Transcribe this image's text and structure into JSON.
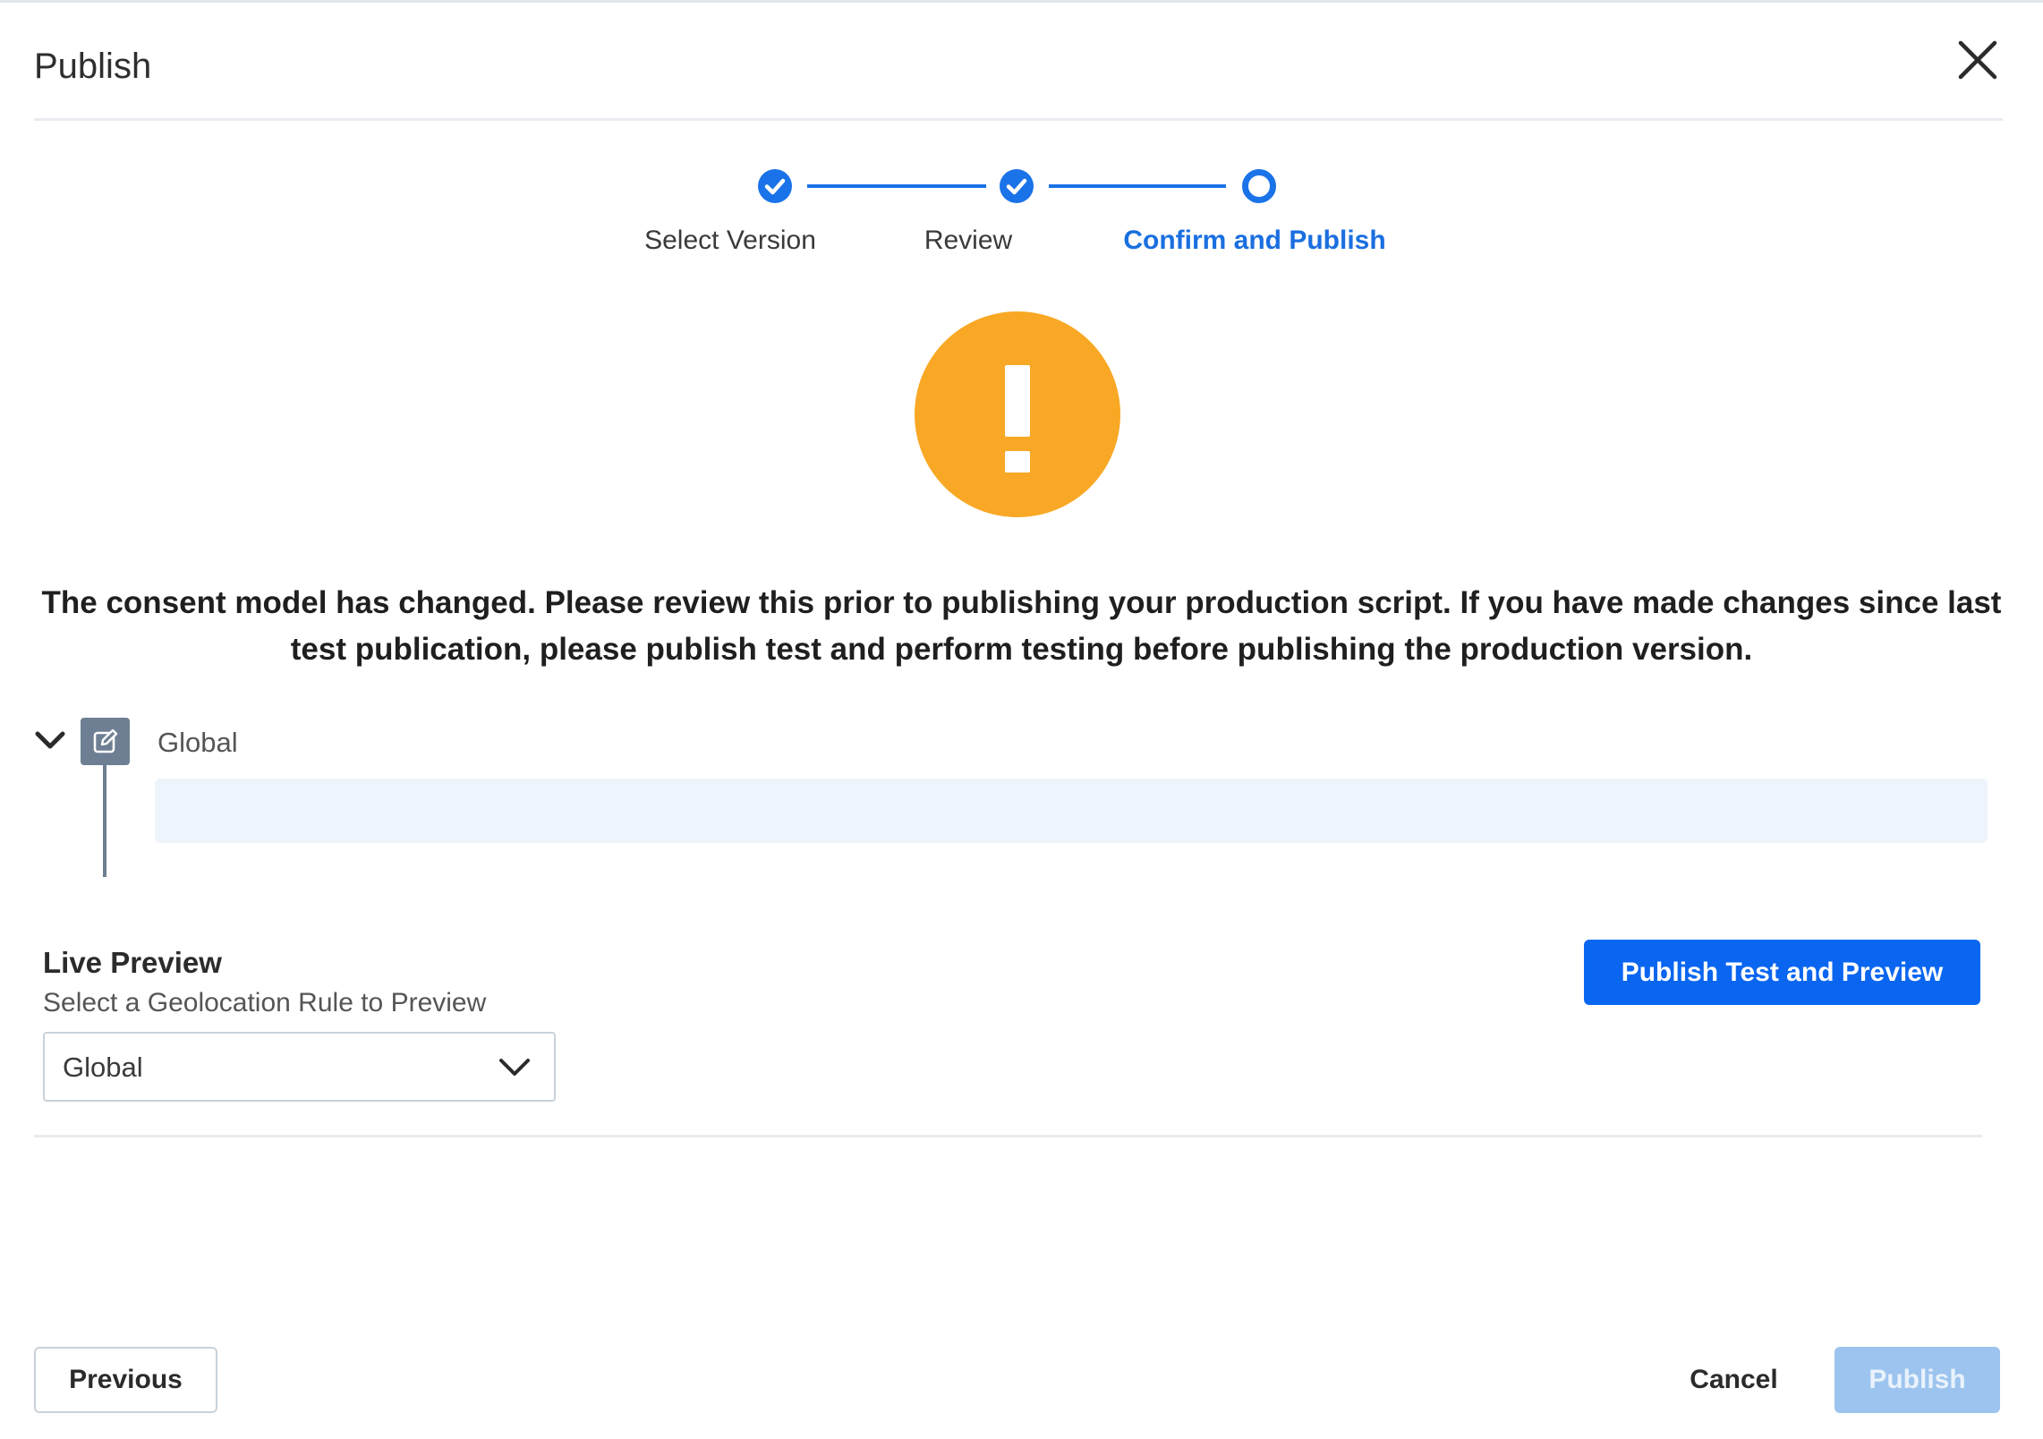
{
  "modal": {
    "title": "Publish"
  },
  "stepper": {
    "steps": [
      {
        "label": "Select Version",
        "state": "done"
      },
      {
        "label": "Review",
        "state": "done"
      },
      {
        "label": "Confirm and Publish",
        "state": "current"
      }
    ]
  },
  "warning": {
    "message": "The consent model has changed. Please review this prior to publishing your production script. If you have made changes since last test publication, please publish test and perform testing before publishing the production version."
  },
  "rules": {
    "group_label": "Global"
  },
  "live_preview": {
    "title": "Live Preview",
    "subtitle": "Select a Geolocation Rule to Preview",
    "selected_rule": "Global",
    "publish_test_label": "Publish Test and Preview"
  },
  "footer": {
    "previous_label": "Previous",
    "cancel_label": "Cancel",
    "publish_label": "Publish"
  },
  "colors": {
    "accent": "#1a73e8",
    "warning": "#f9a825",
    "primary_button": "#0a66f0",
    "disabled_button": "#9cc4ee"
  }
}
